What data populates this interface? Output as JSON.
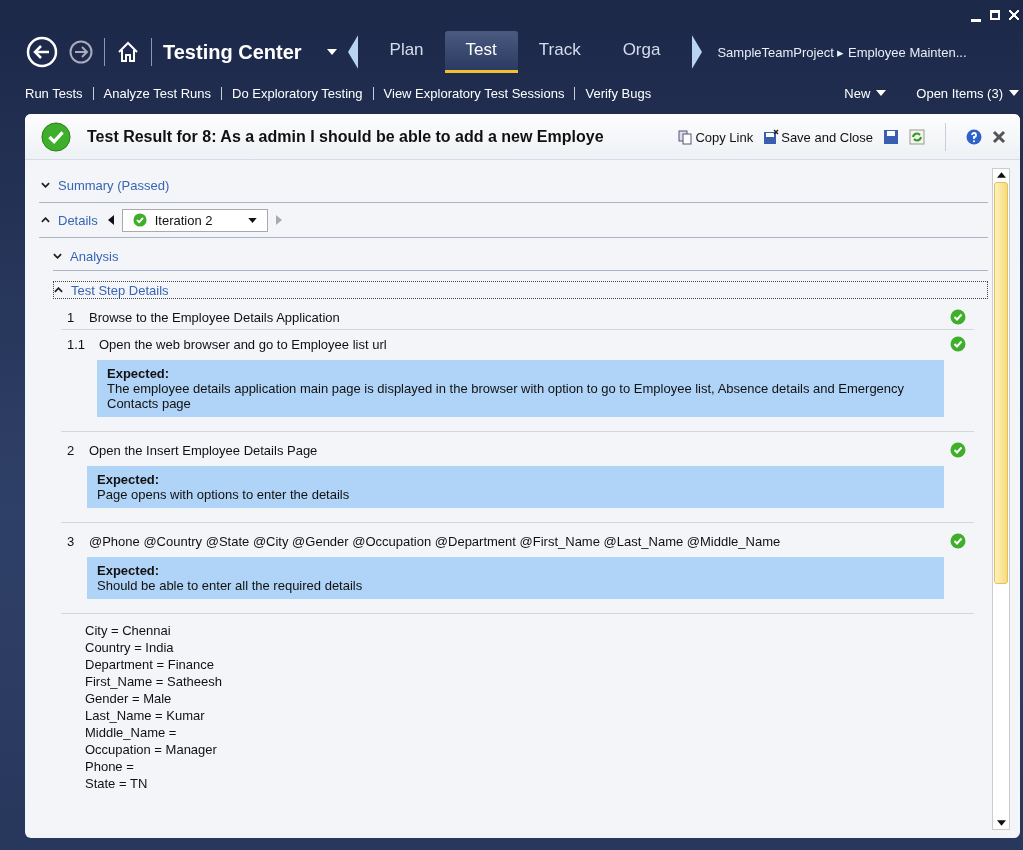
{
  "nav": {
    "title": "Testing Center",
    "tabs": [
      {
        "label": "Plan",
        "selected": false
      },
      {
        "label": "Test",
        "selected": true
      },
      {
        "label": "Track",
        "selected": false
      },
      {
        "label": "Orga",
        "selected": false
      }
    ],
    "breadcrumb": "SampleTeamProject ▸ Employee Mainten..."
  },
  "toolbar": {
    "links": [
      "Run Tests",
      "Analyze Test Runs",
      "Do Exploratory Testing",
      "View Exploratory Test Sessions",
      "Verify Bugs"
    ],
    "menus": [
      "New",
      "Open Items (3)"
    ]
  },
  "result": {
    "passed": true,
    "title": "Test Result for 8: As a admin I should be able to add a new Employe",
    "actions": [
      "Copy Link",
      "Save and Close"
    ]
  },
  "sections": [
    {
      "label": "Summary (Passed)",
      "expanded": false
    },
    {
      "label": "Details",
      "expanded": true
    }
  ],
  "iteration": {
    "label": "Iteration 2",
    "passed": true
  },
  "subsections": [
    {
      "label": "Analysis",
      "expanded": false
    },
    {
      "label": "Test Step Details",
      "expanded": true
    }
  ],
  "steps": [
    {
      "number": "1",
      "action": "Browse to the Employee Details Application",
      "passed": true,
      "children": [
        {
          "number": "1.1",
          "action": "Open the web browser and go to Employee list url",
          "passed": true,
          "expected_label": "Expected:",
          "expected": "The employee details application main page is displayed in the browser with option to go to Employee list, Absence details and Emergency Contacts page"
        }
      ]
    },
    {
      "number": "2",
      "action": "Open the Insert Employee Details Page",
      "passed": true,
      "expected_label": "Expected:",
      "expected": "Page opens with options to enter the details"
    },
    {
      "number": "3",
      "action": "@Phone @Country @State @City @Gender @Occupation @Department @First_Name @Last_Name @Middle_Name",
      "passed": true,
      "expected_label": "Expected:",
      "expected": "Should be able to enter all the required details"
    }
  ],
  "parameters": [
    "City = Chennai",
    "Country = India",
    "Department = Finance",
    "First_Name = Satheesh",
    "Gender = Male",
    "Last_Name = Kumar",
    "Middle_Name =",
    "Occupation = Manager",
    "Phone =",
    "State = TN"
  ]
}
